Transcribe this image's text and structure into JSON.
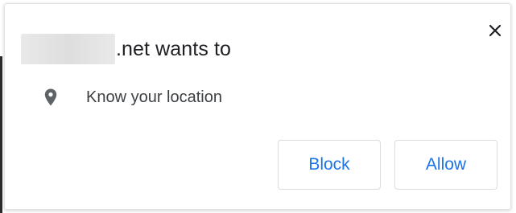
{
  "prompt": {
    "origin_suffix": ".net wants to",
    "permission_label": "Know your location",
    "permission_icon": "location-pin-icon",
    "close_icon": "close-icon"
  },
  "buttons": {
    "block_label": "Block",
    "allow_label": "Allow"
  },
  "colors": {
    "button_text": "#1a73e8",
    "title_text": "#202124",
    "icon": "#5f6368"
  }
}
